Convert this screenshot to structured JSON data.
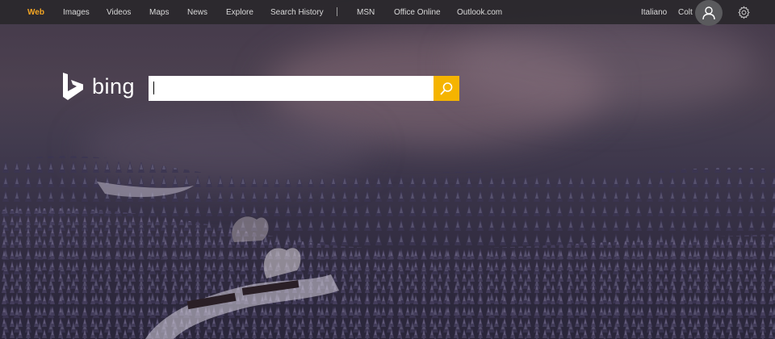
{
  "nav": {
    "items": [
      {
        "label": "Web",
        "active": true
      },
      {
        "label": "Images",
        "active": false
      },
      {
        "label": "Videos",
        "active": false
      },
      {
        "label": "Maps",
        "active": false
      },
      {
        "label": "News",
        "active": false
      },
      {
        "label": "Explore",
        "active": false
      },
      {
        "label": "Search History",
        "active": false
      }
    ],
    "services": [
      {
        "label": "MSN"
      },
      {
        "label": "Office Online"
      },
      {
        "label": "Outlook.com"
      }
    ]
  },
  "header_right": {
    "language": "Italiano",
    "user_name": "Colt",
    "avatar_icon": "user-icon",
    "settings_icon": "gear-icon"
  },
  "logo": {
    "text": "bing",
    "icon": "bing-b-icon"
  },
  "search": {
    "value": "",
    "button_icon": "search-icon"
  },
  "colors": {
    "accent": "#f5a623",
    "search_button": "#f5b400",
    "topbar": "#2a282c"
  }
}
